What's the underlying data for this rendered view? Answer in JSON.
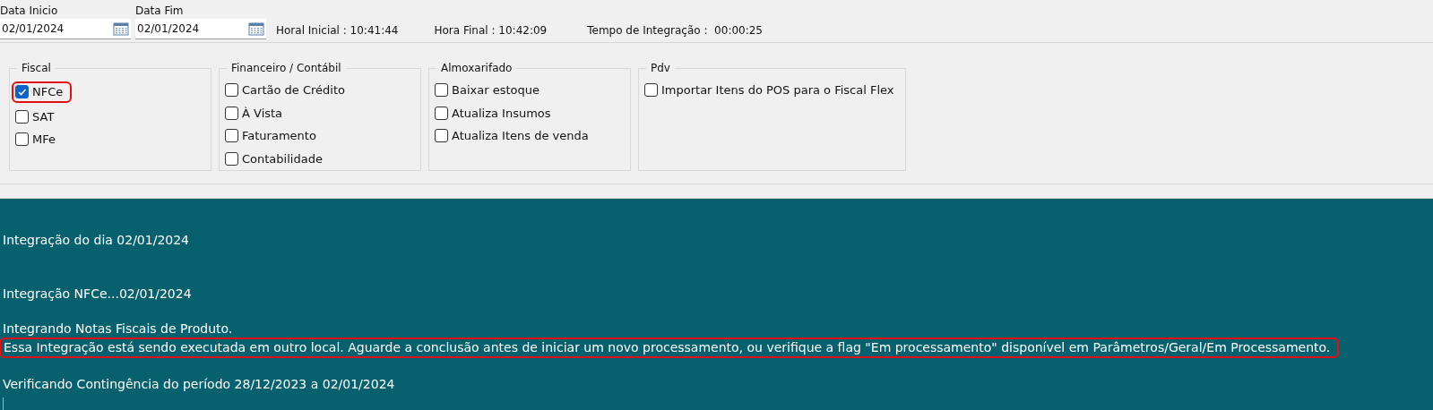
{
  "date_fields": [
    {
      "label": "Data Inicio",
      "value": "02/01/2024"
    },
    {
      "label": "Data Fim",
      "value": "02/01/2024"
    }
  ],
  "times": [
    {
      "label": "Horal Inicial :",
      "value": "10:41:44"
    },
    {
      "label": "Hora Final :",
      "value": "10:42:09"
    },
    {
      "label": "Tempo de Integração :",
      "value": "00:00:25"
    }
  ],
  "groups": [
    {
      "title": "Fiscal",
      "items": [
        {
          "label": "NFCe",
          "checked": true,
          "highlighted": true
        },
        {
          "label": "SAT",
          "checked": false,
          "highlighted": false
        },
        {
          "label": "MFe",
          "checked": false,
          "highlighted": false
        }
      ]
    },
    {
      "title": "Financeiro / Contábil",
      "items": [
        {
          "label": "Cartão de Crédito",
          "checked": false,
          "highlighted": false
        },
        {
          "label": "À Vista",
          "checked": false,
          "highlighted": false
        },
        {
          "label": "Faturamento",
          "checked": false,
          "highlighted": false
        },
        {
          "label": "Contabilidade",
          "checked": false,
          "highlighted": false
        }
      ]
    },
    {
      "title": "Almoxarifado",
      "items": [
        {
          "label": "Baixar estoque",
          "checked": false,
          "highlighted": false
        },
        {
          "label": "Atualiza Insumos",
          "checked": false,
          "highlighted": false
        },
        {
          "label": "Atualiza Itens de venda",
          "checked": false,
          "highlighted": false
        }
      ]
    },
    {
      "title": "Pdv",
      "items": [
        {
          "label": "Importar Itens do POS para o Fiscal Flex",
          "checked": false,
          "highlighted": false
        }
      ]
    }
  ],
  "log": {
    "blocks": [
      [
        {
          "text": "Integração do dia 02/01/2024",
          "highlighted": false
        }
      ],
      [
        {
          "text": "Integração NFCe...02/01/2024",
          "highlighted": false
        }
      ],
      [
        {
          "text": "Integrando Notas Fiscais de Produto.",
          "highlighted": false
        },
        {
          "text": "Essa Integração está sendo executada em outro local. Aguarde a conclusão antes de iniciar um novo processamento, ou verifique a flag \"Em processamento\" disponível em Parâmetros/Geral/Em Processamento.",
          "highlighted": true
        }
      ],
      [
        {
          "text": "Verificando Contingência do período 28/12/2023 a 02/01/2024",
          "highlighted": false
        }
      ]
    ]
  }
}
